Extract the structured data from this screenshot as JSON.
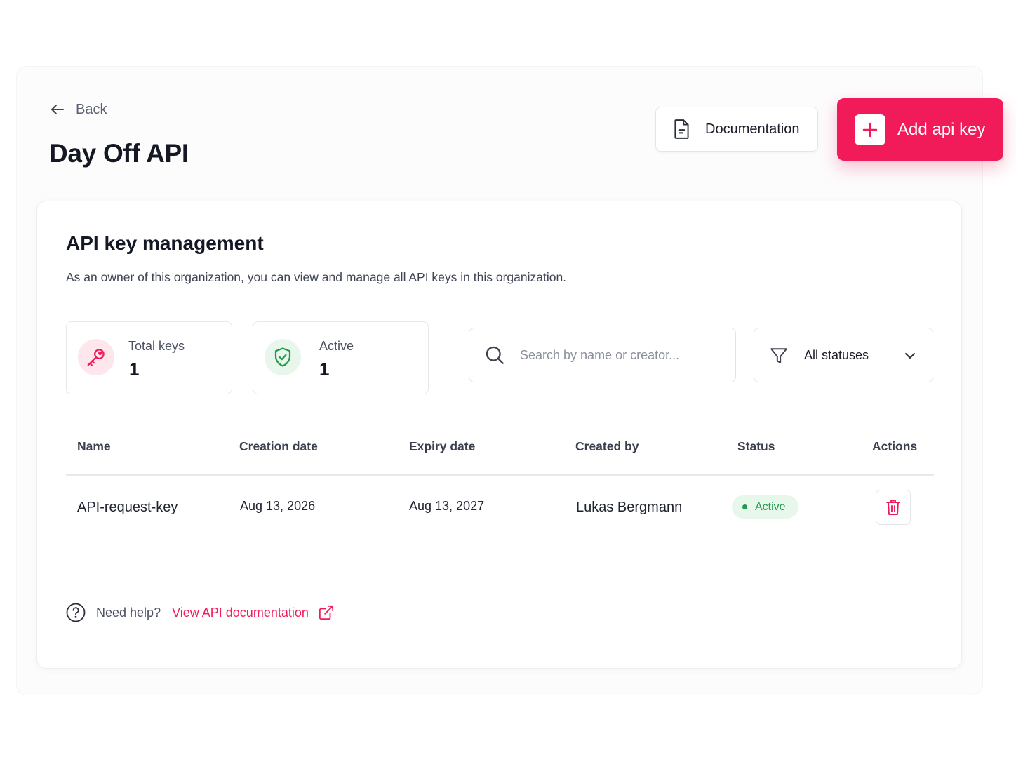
{
  "header": {
    "back_label": "Back",
    "title": "Day Off API",
    "documentation_label": "Documentation",
    "add_key_label": "Add api key"
  },
  "card": {
    "title": "API key management",
    "subtitle": "As an owner of this organization, you can view and manage all API keys in this organization."
  },
  "stats": [
    {
      "label": "Total keys",
      "value": "1",
      "icon": "key-icon"
    },
    {
      "label": "Active",
      "value": "1",
      "icon": "shield-check-icon"
    }
  ],
  "search": {
    "placeholder": "Search by name or creator...",
    "value": ""
  },
  "filter": {
    "selected": "All statuses"
  },
  "table": {
    "columns": [
      "Name",
      "Creation date",
      "Expiry date",
      "Created by",
      "Status",
      "Actions"
    ],
    "rows": [
      {
        "name": "API-request-key",
        "created": "Aug 13, 2026",
        "expiry": "Aug 13, 2027",
        "creator": "Lukas Bergmann",
        "status": "Active"
      }
    ]
  },
  "help": {
    "prompt": "Need help?",
    "link_label": "View API documentation"
  },
  "colors": {
    "accent": "#f21b5a",
    "success": "#1f9a4a",
    "success_bg": "#e7f7ec",
    "key_bg": "#fde7ed",
    "shield_bg": "#e8f6ec"
  }
}
